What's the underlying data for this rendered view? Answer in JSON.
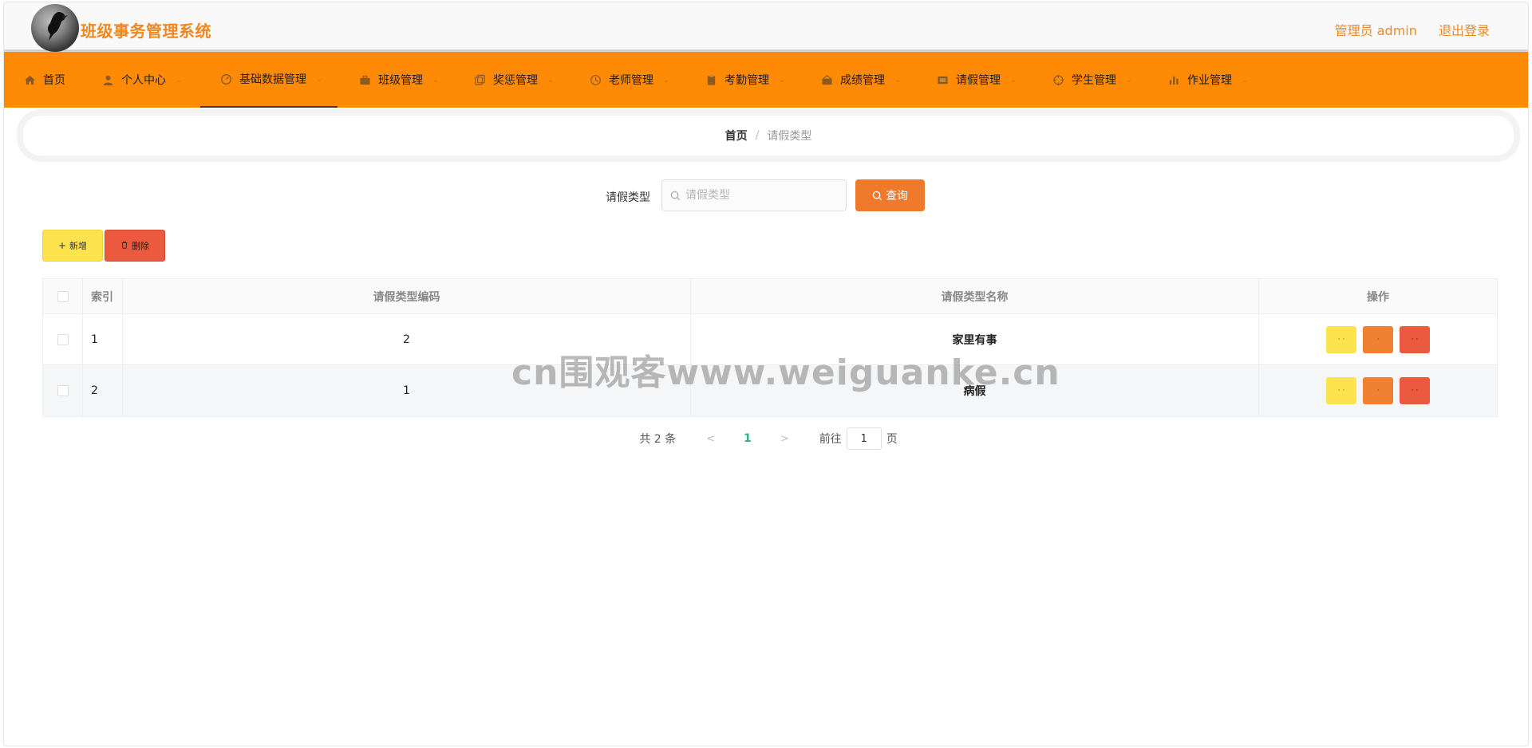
{
  "header": {
    "title": "班级事务管理系统",
    "user_label": "管理员 admin",
    "logout_label": "退出登录"
  },
  "nav": {
    "items": [
      {
        "label": "首页",
        "icon": "home-icon"
      },
      {
        "label": "个人中心",
        "icon": "user-icon"
      },
      {
        "label": "基础数据管理",
        "icon": "dashboard-icon"
      },
      {
        "label": "班级管理",
        "icon": "briefcase-icon"
      },
      {
        "label": "奖惩管理",
        "icon": "copy-icon"
      },
      {
        "label": "老师管理",
        "icon": "clock-icon"
      },
      {
        "label": "考勤管理",
        "icon": "clipboard-icon"
      },
      {
        "label": "成绩管理",
        "icon": "chart-icon"
      },
      {
        "label": "请假管理",
        "icon": "film-icon"
      },
      {
        "label": "学生管理",
        "icon": "crosshair-icon"
      },
      {
        "label": "作业管理",
        "icon": "bar-chart-icon"
      }
    ]
  },
  "breadcrumb": {
    "home": "首页",
    "separator": "/",
    "current": "请假类型"
  },
  "search": {
    "label": "请假类型",
    "placeholder": "请假类型",
    "button_label": "查询"
  },
  "actions": {
    "add_label": "新增",
    "delete_label": "删除"
  },
  "table": {
    "columns": [
      "索引",
      "请假类型编码",
      "请假类型名称",
      "操作"
    ],
    "rows": [
      {
        "index": "1",
        "code": "2",
        "name": "家里有事"
      },
      {
        "index": "2",
        "code": "1",
        "name": "病假"
      }
    ],
    "op_buttons": [
      "· ·",
      "·",
      "· ·"
    ]
  },
  "pagination": {
    "total": "共 2 条",
    "current_page": "1",
    "goto_label": "前往",
    "goto_value": "1",
    "page_suffix": "页"
  },
  "watermark": "cn围观客www.weiguanke.cn",
  "colors": {
    "brand": "#f0871f",
    "nav_bg": "#ff8a05",
    "search_btn": "#f07a2c",
    "add_btn": "#fde34d",
    "delete_btn": "#eb5a3f",
    "page_active": "#2fb37a"
  }
}
